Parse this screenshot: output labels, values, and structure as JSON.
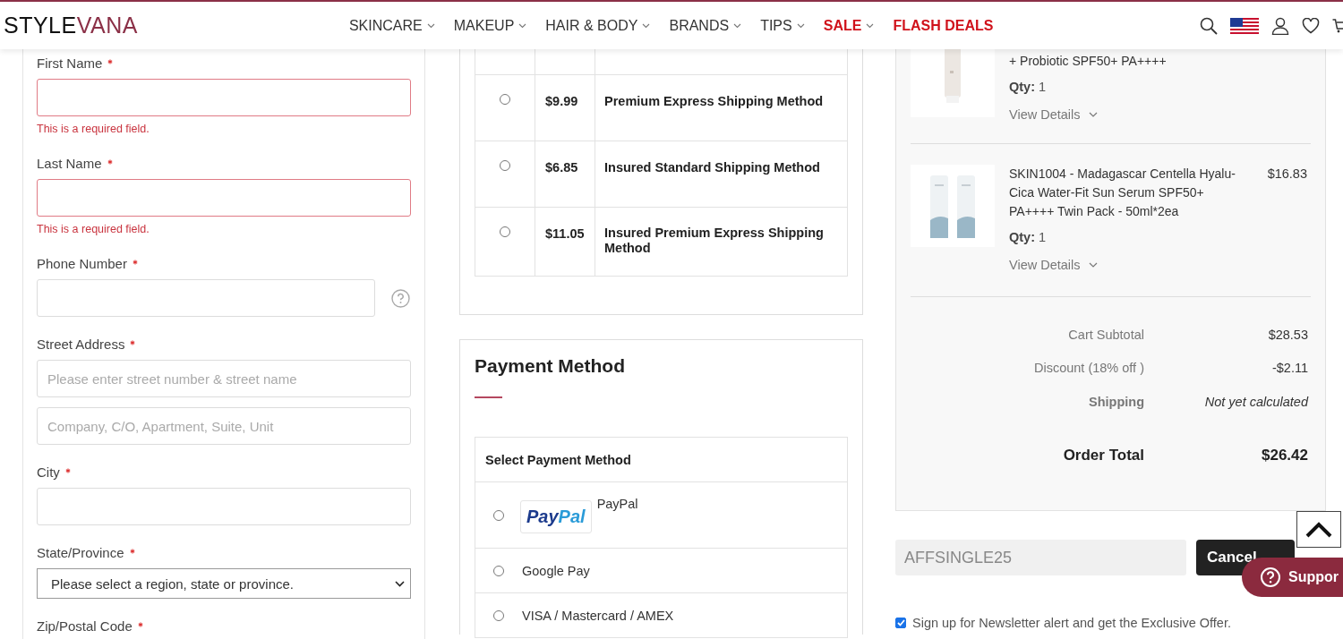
{
  "header": {
    "logo": [
      "STYLE",
      "VANA"
    ],
    "nav": [
      {
        "label": "SKINCARE",
        "dropdown": true,
        "highlight": false
      },
      {
        "label": "MAKEUP",
        "dropdown": true,
        "highlight": false
      },
      {
        "label": "HAIR & BODY",
        "dropdown": true,
        "highlight": false
      },
      {
        "label": "BRANDS",
        "dropdown": true,
        "highlight": false
      },
      {
        "label": "TIPS",
        "dropdown": true,
        "highlight": false
      },
      {
        "label": "SALE",
        "dropdown": true,
        "highlight": true
      },
      {
        "label": "FLASH DEALS",
        "dropdown": false,
        "highlight": true
      }
    ]
  },
  "address_form": {
    "fields": [
      {
        "kind": "text",
        "label": "First Name",
        "required": true,
        "error": "This is a required field."
      },
      {
        "kind": "text",
        "label": "Last Name",
        "required": true,
        "error": "This is a required field."
      },
      {
        "kind": "phone",
        "label": "Phone Number",
        "required": true
      },
      {
        "kind": "address",
        "label": "Street Address",
        "required": true,
        "placeholders": [
          "Please enter street number & street name",
          "Company, C/O, Apartment, Suite, Unit"
        ]
      },
      {
        "kind": "text",
        "label": "City",
        "required": true
      },
      {
        "kind": "select",
        "label": "State/Province",
        "required": true,
        "value": "Please select a region, state or province."
      },
      {
        "kind": "label_only",
        "label": "Zip/Postal Code",
        "required": true
      }
    ]
  },
  "shipping": {
    "rows": [
      {
        "selected": false,
        "price": "$9.99",
        "method": "Premium Express Shipping Method"
      },
      {
        "selected": false,
        "price": "$6.85",
        "method": "Insured Standard Shipping Method"
      },
      {
        "selected": false,
        "price": "$11.05",
        "method": "Insured Premium Express Shipping Method"
      }
    ]
  },
  "payment": {
    "title": "Payment Method",
    "table_heading": "Select Payment Method",
    "options": [
      {
        "kind": "paypal",
        "logo": [
          "Pay",
          "Pal"
        ],
        "label": "PayPal",
        "selected": false
      },
      {
        "kind": "plain",
        "label": "Google Pay",
        "selected": false
      },
      {
        "kind": "plain",
        "label": "VISA / Mastercard / AMEX",
        "selected": false
      }
    ]
  },
  "order_summary": {
    "items": [
      {
        "name": "+ Probiotic SPF50+ PA++++",
        "qty_label": "Qty:",
        "qty": "1",
        "details": "View Details"
      },
      {
        "name": "SKIN1004 - Madagascar Centella Hyalu-Cica Water-Fit Sun Serum SPF50+ PA++++ Twin Pack - 50ml*2ea",
        "price": "$16.83",
        "qty_label": "Qty:",
        "qty": "1",
        "details": "View Details"
      }
    ],
    "totals": [
      {
        "kind": "normal",
        "label": "Cart Subtotal",
        "value": "$28.53"
      },
      {
        "kind": "normal",
        "label": "Discount (18% off )",
        "value": "-$2.11"
      },
      {
        "kind": "pending",
        "label": "Shipping",
        "value": "Not yet calculated"
      },
      {
        "kind": "total",
        "label": "Order Total",
        "value": "$26.42"
      }
    ]
  },
  "coupon": {
    "value": "AFFSINGLE25",
    "button": "Cancel"
  },
  "newsletter": {
    "checked": true,
    "label": "Sign up for Newsletter alert and get the Exclusive Offer."
  },
  "support": {
    "label": "Suppor"
  }
}
